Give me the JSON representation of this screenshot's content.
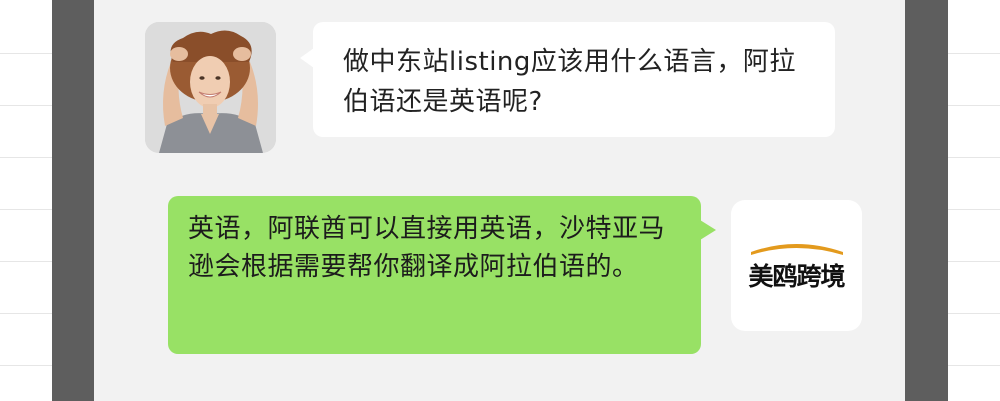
{
  "messages": [
    {
      "side": "left",
      "sender_avatar": "woman-photo-avatar",
      "text": "做中东站listing应该用什么语言，阿拉伯语还是英语呢?"
    },
    {
      "side": "right",
      "sender_avatar": "meiou-kuajing-logo-avatar",
      "text": "英语，阿联酋可以直接用英语，沙特亚马逊会根据需要帮你翻译成阿拉伯语的。"
    }
  ],
  "logo": {
    "text": "美鸥跨境",
    "arc_color": "#e39a1d"
  },
  "colors": {
    "frame": "#5e5e5e",
    "chat_background": "#f2f2f2",
    "incoming_bubble": "#ffffff",
    "outgoing_bubble": "#98e165"
  }
}
